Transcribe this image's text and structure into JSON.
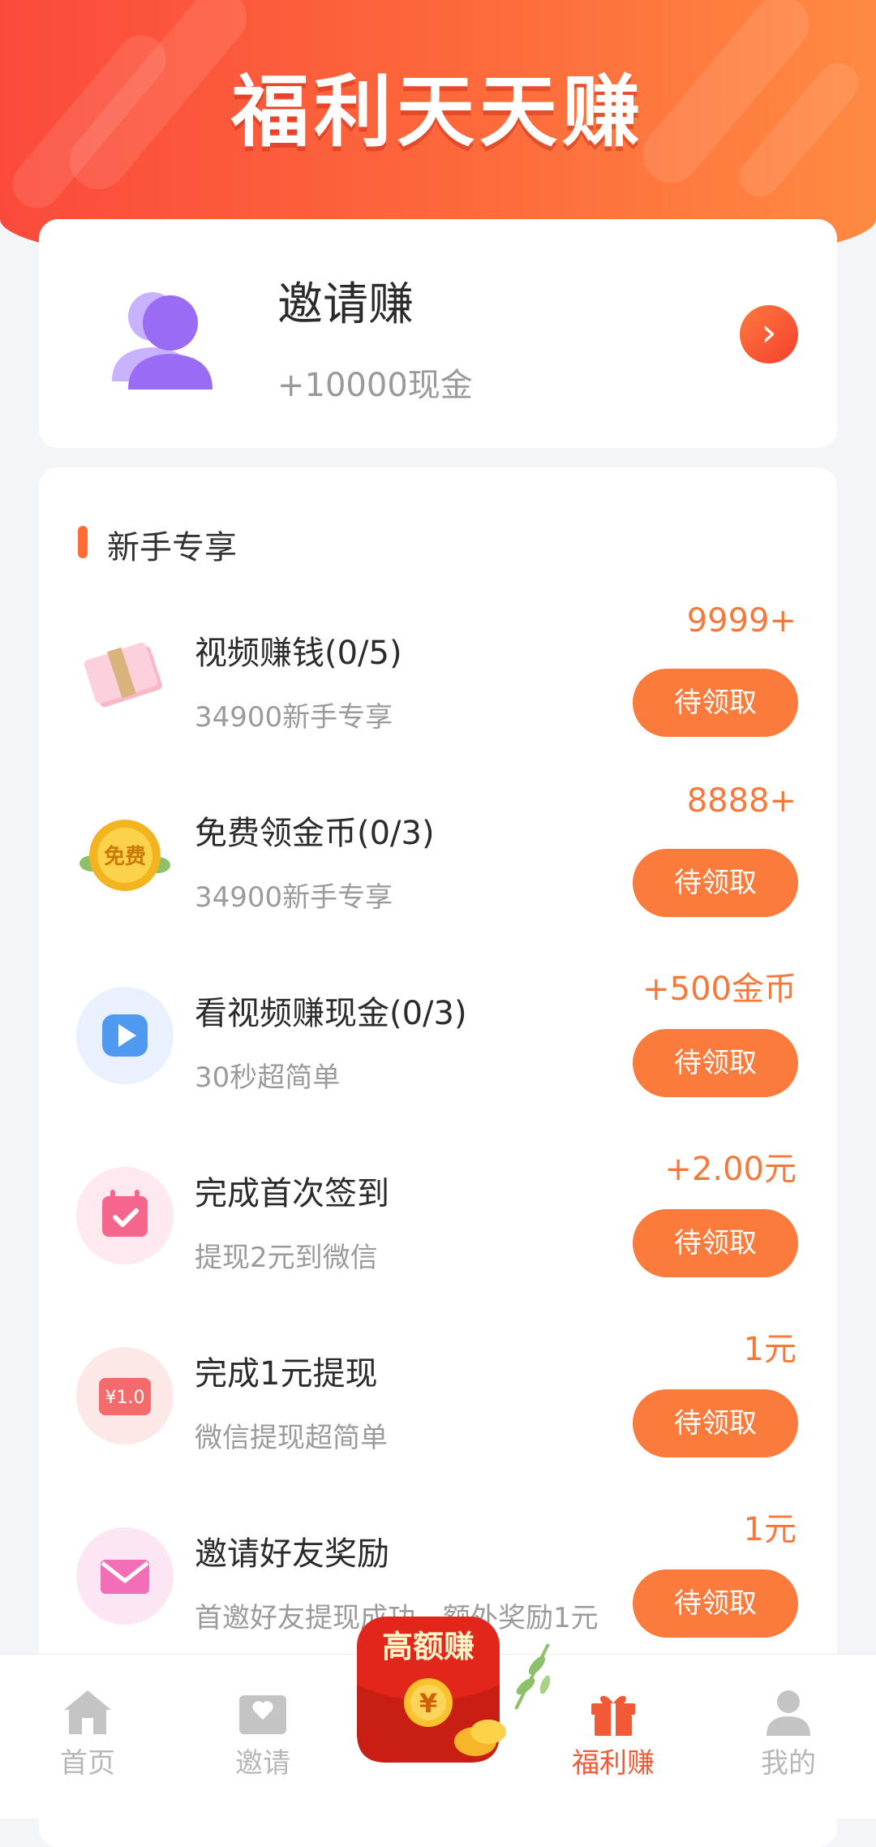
{
  "header": {
    "title": "福利天天赚"
  },
  "invite_card": {
    "title": "邀请赚",
    "subtitle": "+10000现金",
    "icon": "user-group-icon",
    "arrow_icon": "chevron-right-icon"
  },
  "section": {
    "title": "新手专享"
  },
  "tasks": [
    {
      "name": "视频赚钱(0/5)",
      "desc": "34900新手专享",
      "reward": "9999+",
      "button": "待领取",
      "icon": "cash-bundle-icon"
    },
    {
      "name": "免费领金币(0/3)",
      "desc": "34900新手专享",
      "reward": "8888+",
      "button": "待领取",
      "icon": "free-coin-icon"
    },
    {
      "name": "看视频赚现金(0/3)",
      "desc": "30秒超简单",
      "reward": "+500金币",
      "button": "待领取",
      "icon": "video-play-icon"
    },
    {
      "name": "完成首次签到",
      "desc": "提现2元到微信",
      "reward": "+2.00元",
      "button": "待领取",
      "icon": "calendar-check-icon"
    },
    {
      "name": "完成1元提现",
      "desc": "微信提现超简单",
      "reward": "1元",
      "button": "待领取",
      "icon": "yuan-card-icon",
      "icon_text": "¥1.0"
    },
    {
      "name": "邀请好友奖励",
      "desc": "首邀好友提现成功，额外奖励1元",
      "reward": "1元",
      "button": "待领取",
      "icon": "envelope-icon"
    }
  ],
  "tabbar": {
    "items": [
      {
        "label": "首页",
        "icon": "home-icon"
      },
      {
        "label": "邀请",
        "icon": "invite-heart-icon"
      },
      {
        "label": "福利赚",
        "icon": "gift-icon",
        "active": true
      },
      {
        "label": "我的",
        "icon": "profile-icon"
      }
    ],
    "center": {
      "label": "高额赚",
      "icon": "red-envelope-icon",
      "symbol": "¥"
    }
  },
  "colors": {
    "accent": "#fb7b3c",
    "header_start": "#fb4a3c",
    "header_end": "#fe8a42",
    "active_tab": "#f15a35"
  }
}
